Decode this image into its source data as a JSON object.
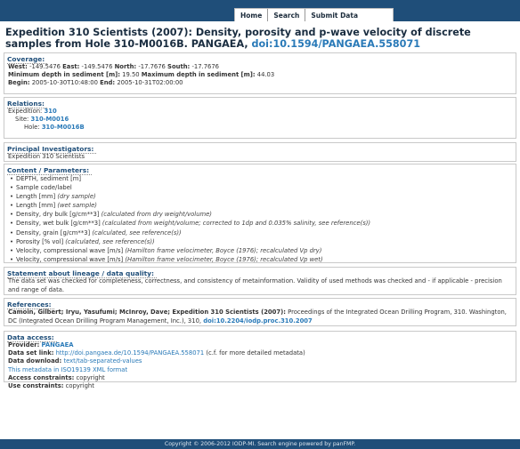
{
  "nav": {
    "home": "Home",
    "search": "Search",
    "submit": "Submit Data"
  },
  "title": {
    "text": "Expedition 310 Scientists (2007): Density, porosity and p-wave velocity of discrete samples from Hole 310-M0016B. PANGAEA,",
    "doi": "doi:10.1594/PANGAEA.558071"
  },
  "coverage": {
    "heading": "Coverage:",
    "west_label": "West:",
    "west": "-149.5476",
    "east_label": "East:",
    "east": "-149.5476",
    "north_label": "North:",
    "north": "-17.7676",
    "south_label": "South:",
    "south": "-17.7676",
    "min_depth_label": "Minimum depth in sediment [m]:",
    "min_depth": "19.50",
    "max_depth_label": "Maximum depth in sediment [m]:",
    "max_depth": "44.03",
    "begin_label": "Begin:",
    "begin": "2005-10-30T10:48:00",
    "end_label": "End:",
    "end": "2005-10-31T02:00:00"
  },
  "relations": {
    "heading": "Relations:",
    "expedition_label": "Expedition:",
    "expedition": "310",
    "site_label": "Site:",
    "site": "310-M0016",
    "hole_label": "Hole:",
    "hole": "310-M0016B"
  },
  "investigators": {
    "heading": "Principal Investigators:",
    "value": "Expedition 310 Scientists"
  },
  "parameters": {
    "heading": "Content / Parameters:",
    "items": [
      {
        "name": "DEPTH, sediment [m]",
        "comment": ""
      },
      {
        "name": "Sample code/label",
        "comment": ""
      },
      {
        "name": "Length [mm]",
        "comment": "(dry sample)"
      },
      {
        "name": "Length [mm]",
        "comment": "(wet sample)"
      },
      {
        "name": "Density, dry bulk [g/cm**3]",
        "comment": "(calculated from dry weight/volume)"
      },
      {
        "name": "Density, wet bulk [g/cm**3]",
        "comment": "(calculated from weight/volume; corrected to 1dp and 0.035% salinity, see reference(s))"
      },
      {
        "name": "Density, grain [g/cm**3]",
        "comment": "(calculated, see reference(s))"
      },
      {
        "name": "Porosity [% vol]",
        "comment": "(calculated, see reference(s))"
      },
      {
        "name": "Velocity, compressional wave [m/s]",
        "comment": "(Hamilton frame velocimeter, Boyce (1976); recalculated Vp dry)"
      },
      {
        "name": "Velocity, compressional wave [m/s]",
        "comment": "(Hamilton frame velocimeter, Boyce (1976); recalculated Vp wet)"
      }
    ]
  },
  "lineage": {
    "heading": "Statement about lineage / data quality:",
    "text": "The data set was checked for completeness, correctness, and consistency of metainformation. Validity of used methods was checked and - if applicable - precision and range of data."
  },
  "references": {
    "heading": "References:",
    "authors": "Camoin, Gilbert; Iryu, Yasufumi; McInroy, Dave; Expedition 310 Scientists (2007):",
    "text": "Proceedings of the Integrated Ocean Drilling Program, 310. Washington, DC (Integrated Ocean Drilling Program Management, Inc.), 310,",
    "doi": "doi:10.2204/iodp.proc.310.2007"
  },
  "access": {
    "heading": "Data access:",
    "provider_label": "Provider:",
    "provider": "PANGAEA",
    "link_label": "Data set link:",
    "link": "http://doi.pangaea.de/10.1594/PANGAEA.558071",
    "link_note": "(c.f. for more detailed metadata)",
    "download_label": "Data download:",
    "download": "text/tab-separated-values",
    "iso_link": "This metadata in ISO19139 XML format",
    "access_label": "Access constraints:",
    "access_value": "copyright",
    "use_label": "Use constraints:",
    "use_value": "copyright"
  },
  "footer": "Copyright © 2006-2012 IODP-MI. Search engine powered by panFMP."
}
